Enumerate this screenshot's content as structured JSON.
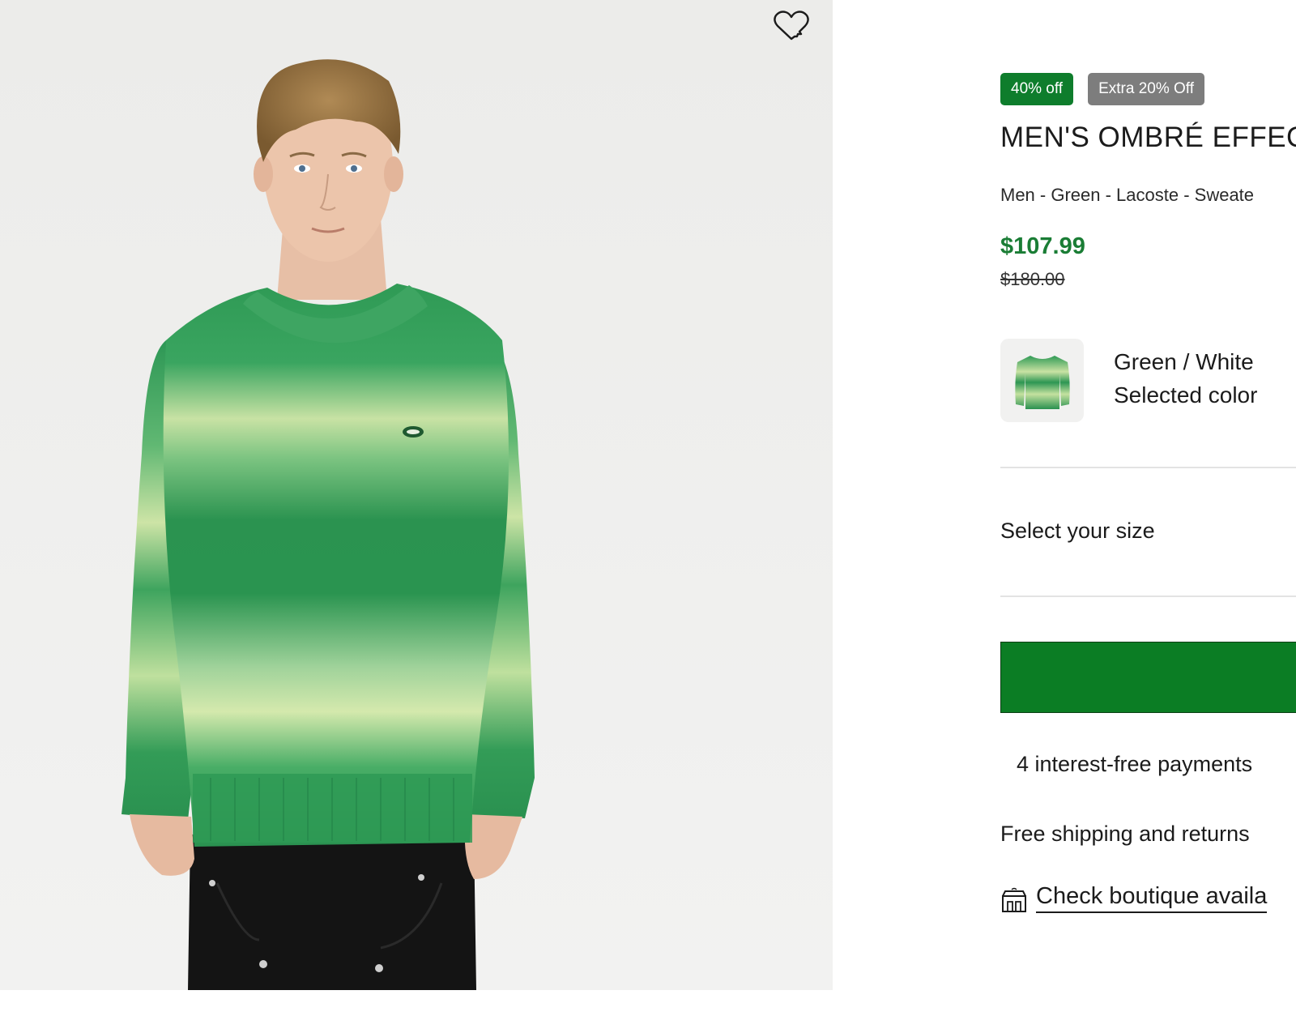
{
  "gallery": {
    "image_alt": "Man wearing green and white ombré effect mohair sweater",
    "wishlist_icon": "heart-outline-icon"
  },
  "product": {
    "badges": {
      "discount": "40% off",
      "extra": "Extra 20% Off"
    },
    "title": "MEN'S OMBRÉ EFFEC",
    "breadcrumb": "Men - Green - Lacoste - Sweate",
    "price_current": "$107.99",
    "price_original": "$180.00",
    "color": {
      "name": "Green / White",
      "subtitle": "Selected color",
      "swatch_icon": "sweater-thumbnail"
    },
    "size_label": "Select your size",
    "payments_text": "4 interest-free payments",
    "shipping_text": "Free shipping and returns",
    "boutique_link": "Check boutique availa",
    "boutique_icon": "store-icon"
  },
  "colors": {
    "sale_badge": "#0e7d2c",
    "extra_badge": "#7d7d7d",
    "price": "#1a7d35",
    "add_to_cart": "#0b7d24"
  }
}
